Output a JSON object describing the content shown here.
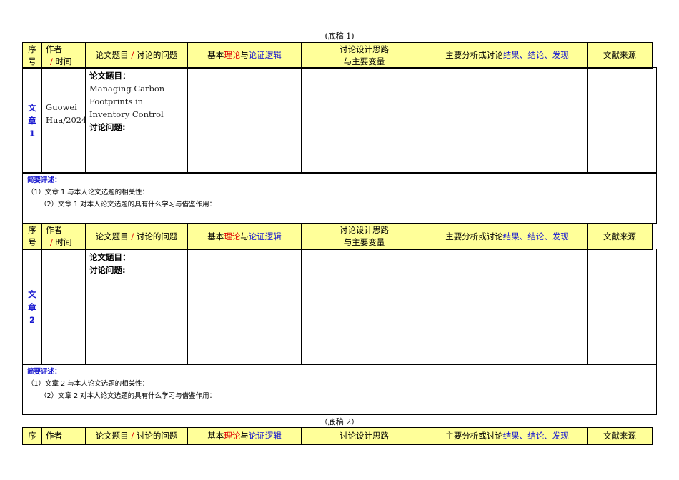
{
  "draft1_title": "(底稿 1)",
  "draft2_title": "（底稿 2）",
  "header": {
    "seq": [
      "序",
      "号"
    ],
    "author": [
      "作者",
      "/",
      "时间"
    ],
    "topic": [
      "论文题目",
      "/",
      "讨论的问题"
    ],
    "theory": [
      "基本",
      "理论",
      "与",
      "论证逻辑"
    ],
    "design": [
      "讨论设计思路",
      "与主要变量"
    ],
    "results": [
      "主要分析或讨论",
      "结果、结论、发现"
    ],
    "source": "文献来源"
  },
  "articles": [
    {
      "seq": [
        "文",
        "章",
        "1"
      ],
      "author": [
        "Guowei",
        "Hua/2024"
      ],
      "topic_label": "论文题目：",
      "topic_title": "Managing Carbon Footprints in Inventory Control",
      "question_label": "讨论问题:",
      "review_title": "简要评述：",
      "review_1": "（1）文章 1 与本人论文选题的相关性：",
      "review_2": "（2）文章 1 对本人论文选题的具有什么学习与借鉴作用："
    },
    {
      "seq": [
        "文",
        "章",
        "2"
      ],
      "author": [
        "",
        ""
      ],
      "topic_label": "论文题目：",
      "topic_title": "",
      "question_label": "讨论问题:",
      "review_title": "简要评述：",
      "review_1": "（1）文章 2 与本人论文选题的相关性：",
      "review_2": "（2）文章 2 对本人论文选题的具有什么学习与借鉴作用："
    }
  ],
  "header3": {
    "seq": "序",
    "author": "作者",
    "design": "讨论设计思路"
  }
}
